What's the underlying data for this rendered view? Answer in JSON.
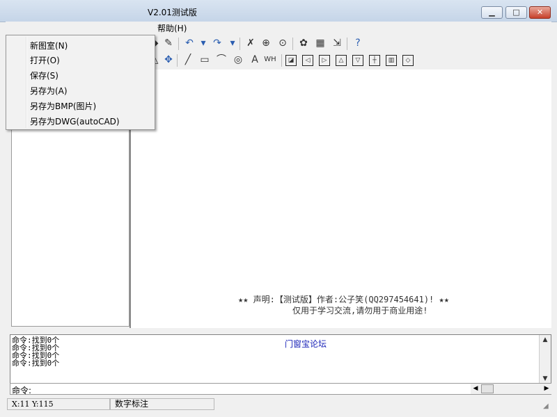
{
  "window": {
    "title": "V2.01测试版",
    "controls": {
      "minimize_glyph": "▁",
      "maximize_glyph": "□",
      "close_glyph": "✕"
    }
  },
  "menubar": {
    "help": "帮助(H)"
  },
  "file_menu": {
    "items": [
      {
        "label": "新图室(N)"
      },
      {
        "label": "打开(O)"
      },
      {
        "label": "保存(S)"
      },
      {
        "label": "另存为(A)"
      },
      {
        "label": "另存为BMP(图片)"
      },
      {
        "label": "另存为DWG(autoCAD)"
      }
    ]
  },
  "toolbar_row1": {
    "icons": [
      {
        "name": "paint-bucket-icon",
        "glyph": "◆"
      },
      {
        "name": "brush-icon",
        "glyph": "✎"
      },
      {
        "name": "undo-icon",
        "glyph": "↶"
      },
      {
        "name": "undo-dropdown-icon",
        "glyph": "▾"
      },
      {
        "name": "redo-icon",
        "glyph": "↷"
      },
      {
        "name": "redo-dropdown-icon",
        "glyph": "▾"
      },
      {
        "name": "eraser-icon",
        "glyph": "✗"
      },
      {
        "name": "zoom-in-icon",
        "glyph": "⊕"
      },
      {
        "name": "zoom-fit-icon",
        "glyph": "⊙"
      },
      {
        "name": "palette-icon",
        "glyph": "✿"
      },
      {
        "name": "grid-view-icon",
        "glyph": "▦"
      },
      {
        "name": "export-icon",
        "glyph": "⇲"
      },
      {
        "name": "help-icon",
        "glyph": "?"
      }
    ]
  },
  "toolbar_row2": {
    "icons": [
      {
        "name": "triangle-tool-icon",
        "glyph": "△"
      },
      {
        "name": "move-icon",
        "glyph": "✥"
      },
      {
        "name": "line-tool-icon",
        "glyph": "╱"
      },
      {
        "name": "rectangle-tool-icon",
        "glyph": "▭"
      },
      {
        "name": "arc-tool-icon",
        "glyph": "⌒"
      },
      {
        "name": "circle-tool-icon",
        "glyph": "◎"
      },
      {
        "name": "text-tool-icon",
        "glyph": "A"
      },
      {
        "name": "dimension-tool-icon",
        "glyph": "WH"
      },
      {
        "name": "window-pane-icon",
        "glyph": "◪"
      },
      {
        "name": "window-left-icon",
        "glyph": "◁"
      },
      {
        "name": "window-right-icon",
        "glyph": "▷"
      },
      {
        "name": "window-up-icon",
        "glyph": "△"
      },
      {
        "name": "window-down-icon",
        "glyph": "▽"
      },
      {
        "name": "window-cross-icon",
        "glyph": "┼"
      },
      {
        "name": "window-bars-icon",
        "glyph": "▥"
      },
      {
        "name": "window-diamond-icon",
        "glyph": "◇"
      }
    ]
  },
  "canvas": {
    "notice_line1": "★★ 声明:【测试版】作者:公子笑(QQ297454641)! ★★",
    "notice_line2": "仅用于学习交流,请勿用于商业用途!"
  },
  "output": {
    "lines": [
      "命令:找到0个",
      "命令:找到0个",
      "命令:找到0个",
      "命令:找到0个"
    ],
    "forum_link": "门窗宝论坛"
  },
  "command": {
    "prompt": "命令:"
  },
  "status": {
    "coords": "X:11  Y:115",
    "mode": "数字标注"
  }
}
